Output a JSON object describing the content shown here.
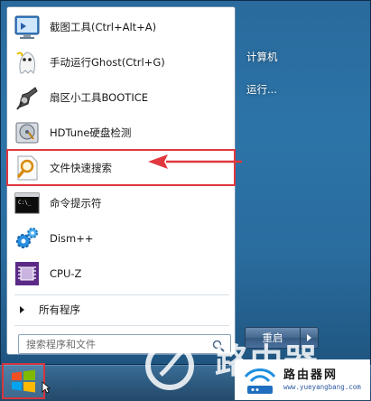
{
  "start_menu": {
    "programs": [
      {
        "label": "截图工具(Ctrl+Alt+A)",
        "icon": "screenshot-tool-icon"
      },
      {
        "label": "手动运行Ghost(Ctrl+G)",
        "icon": "ghost-icon"
      },
      {
        "label": "扇区小工具BOOTICE",
        "icon": "bootice-icon"
      },
      {
        "label": "HDTune硬盘检测",
        "icon": "hard-disk-icon"
      },
      {
        "label": "文件快速搜索",
        "icon": "magnifier-file-icon"
      },
      {
        "label": "命令提示符",
        "icon": "command-prompt-icon"
      },
      {
        "label": "Dism++",
        "icon": "dism-gears-icon"
      },
      {
        "label": "CPU-Z",
        "icon": "cpuz-chip-icon"
      }
    ],
    "all_programs_label": "所有程序",
    "search": {
      "placeholder": "搜索程序和文件"
    },
    "right_links": {
      "computer": "计算机",
      "run": "运行..."
    },
    "shutdown": {
      "label": "重启"
    }
  },
  "watermark": {
    "brand_chars": "路由器",
    "site_name": "路由器网",
    "site_url": "www.yueyangbang.com"
  },
  "colors": {
    "highlight_border": "#e0383e",
    "menu_blue": "#2a6c9e",
    "taskbar": "#2d5a7f"
  }
}
